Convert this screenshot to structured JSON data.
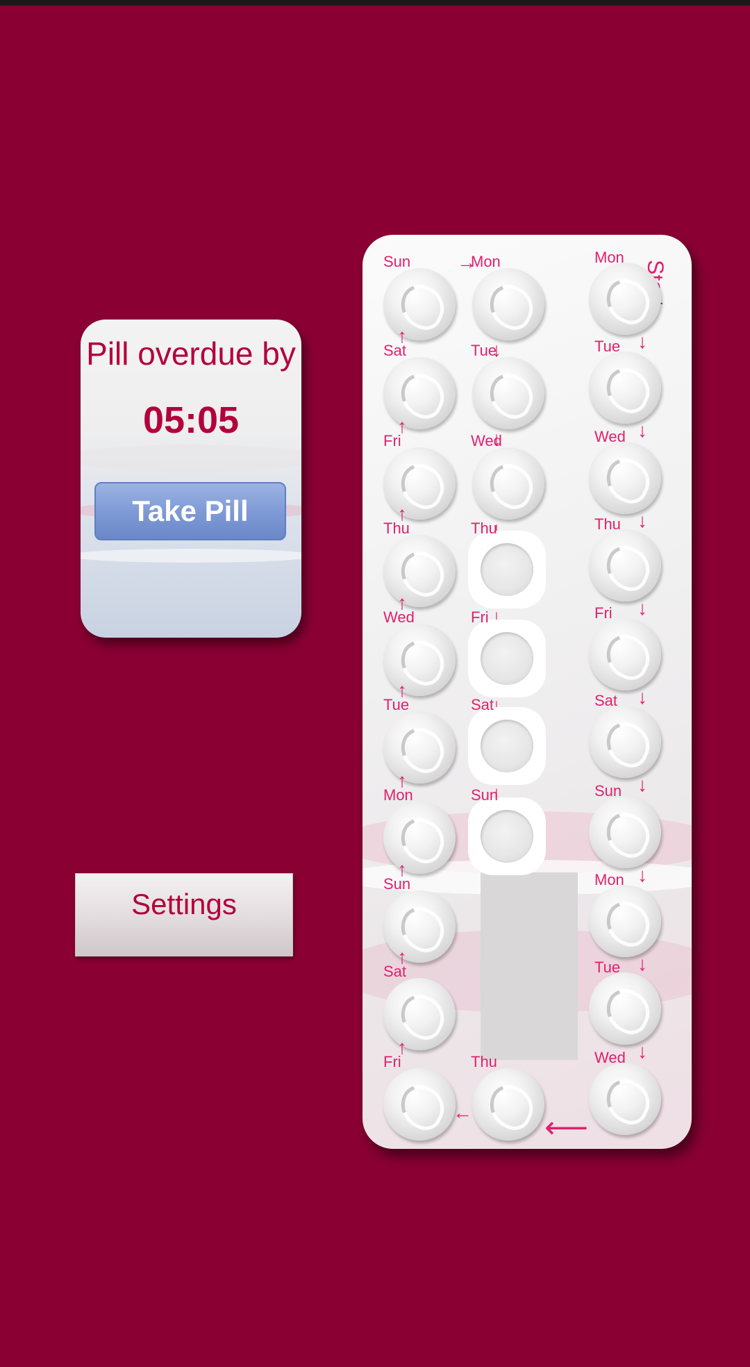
{
  "status_card": {
    "overdue_label": "Pill overdue by",
    "overdue_time": "05:05",
    "take_pill_label": "Take Pill"
  },
  "settings_label": "Settings",
  "pack": {
    "start_label": "Start",
    "left_column": [
      "Sun",
      "Sat",
      "Fri",
      "Thu",
      "Wed",
      "Tue",
      "Mon",
      "Sun",
      "Sat",
      "Fri"
    ],
    "middle_column": [
      "Mon",
      "Tue",
      "Wed",
      "Thu",
      "Fri",
      "Sat",
      "Sun",
      "Thu"
    ],
    "right_column": [
      "Mon",
      "Tue",
      "Wed",
      "Thu",
      "Fri",
      "Sat",
      "Sun",
      "Mon",
      "Tue",
      "Wed"
    ],
    "taken_middle_days": [
      "Thu",
      "Fri",
      "Sat",
      "Sun"
    ]
  },
  "colors": {
    "background": "#8a0033",
    "accent": "#b3003d",
    "day_text": "#e0206e",
    "button_blue": "#7f9bd6"
  }
}
